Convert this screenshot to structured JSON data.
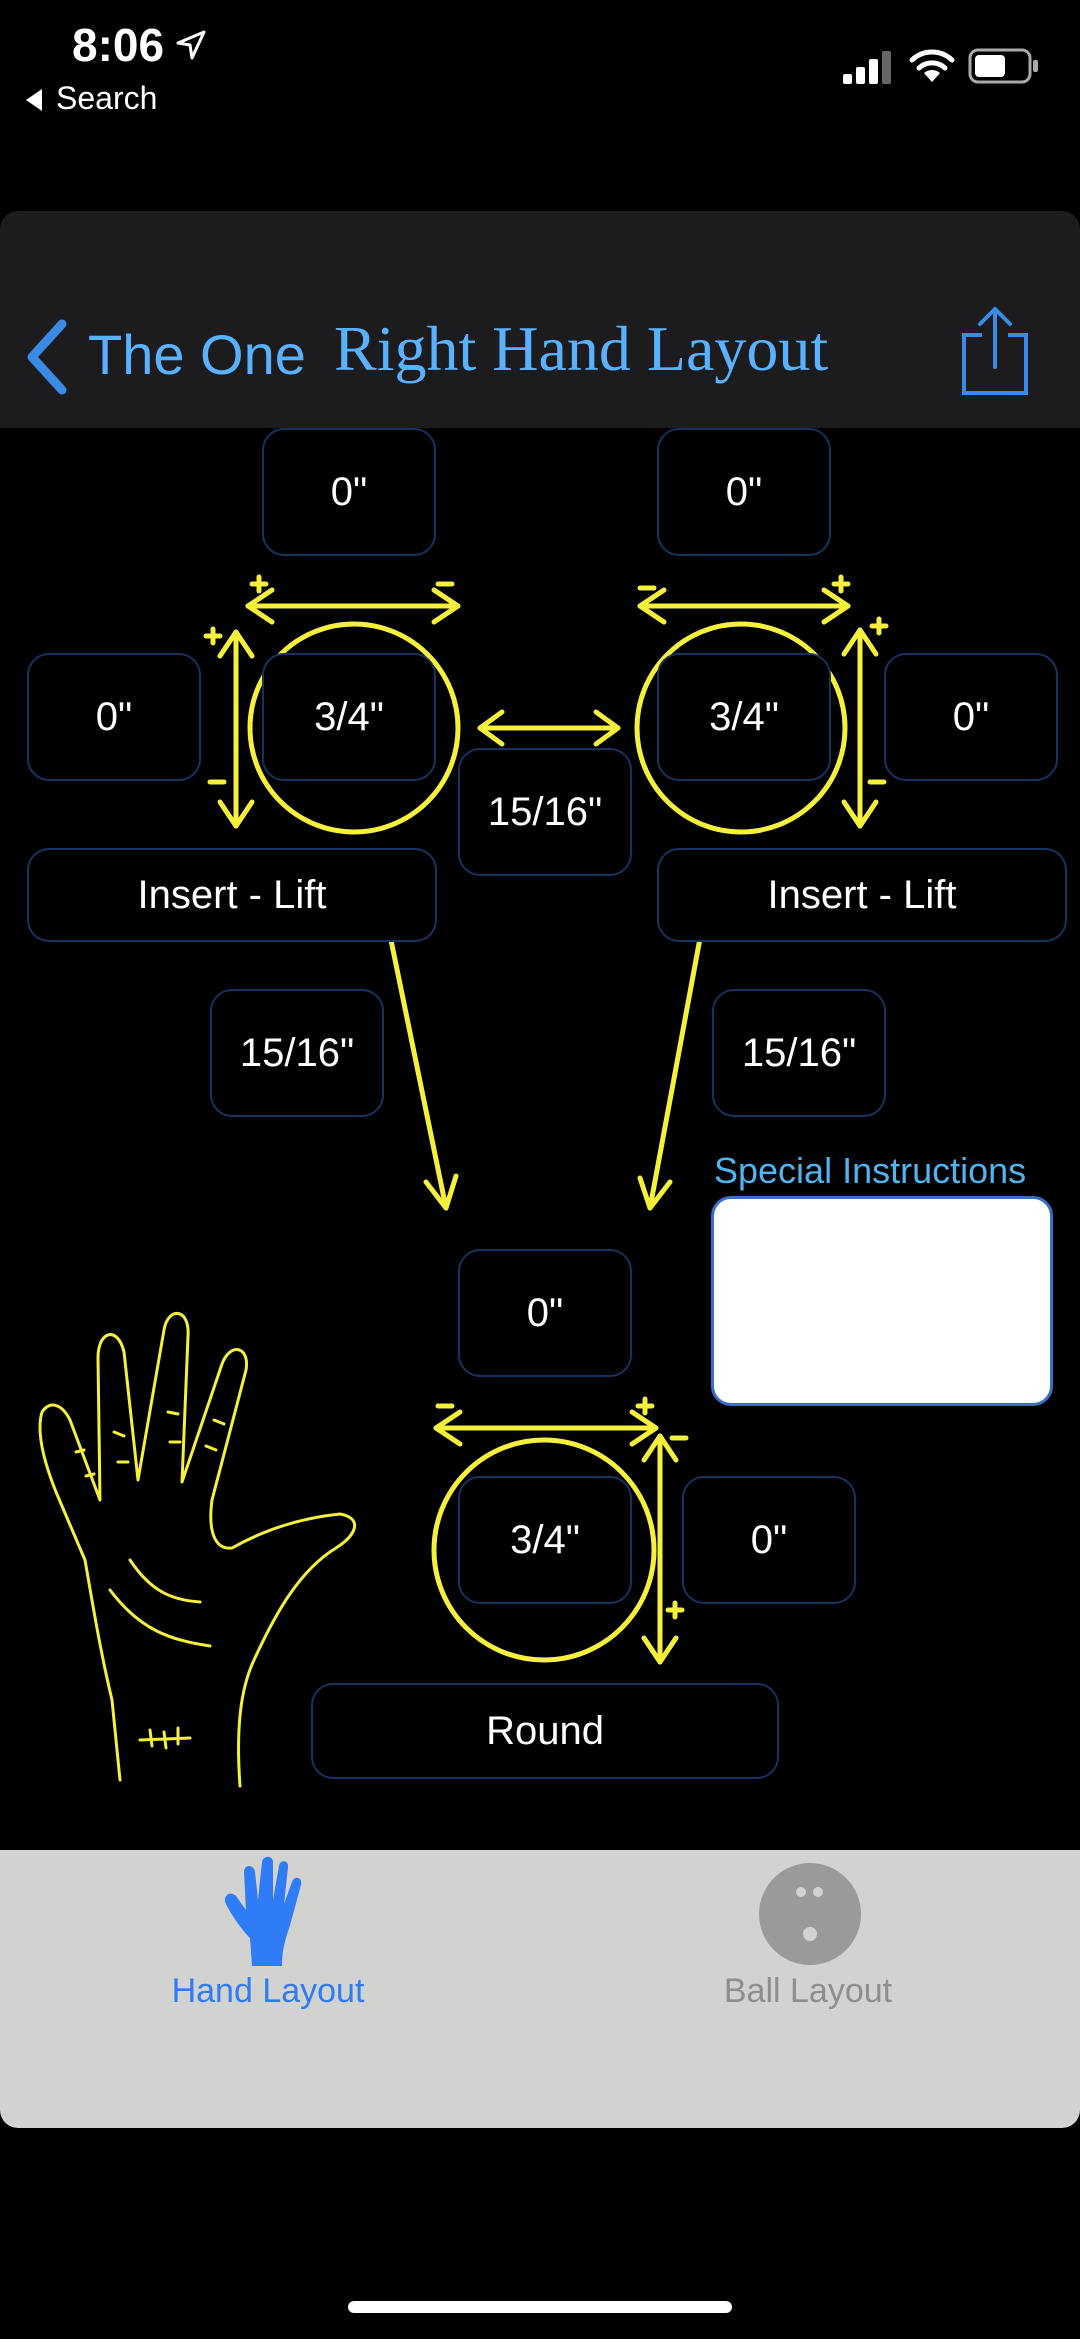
{
  "status_bar": {
    "time": "8:06",
    "back_label": "Search"
  },
  "nav": {
    "back_label": "The One",
    "title": "Right Hand Layout"
  },
  "left_finger": {
    "top_pitch": "0\"",
    "size": "3/4\"",
    "side_pitch": "0\"",
    "insert": "Insert - Lift",
    "span": "15/16\""
  },
  "right_finger": {
    "top_pitch": "0\"",
    "size": "3/4\"",
    "side_pitch": "0\"",
    "insert": "Insert - Lift",
    "span": "15/16\""
  },
  "bridge": "15/16\"",
  "thumb": {
    "top_pitch": "0\"",
    "size": "3/4\"",
    "side_pitch": "0\"",
    "shape": "Round"
  },
  "special_instructions": {
    "label": "Special Instructions",
    "value": ""
  },
  "tabs": [
    {
      "label": "Hand Layout",
      "icon": "hand-icon",
      "active": true
    },
    {
      "label": "Ball Layout",
      "icon": "bowling-ball-icon",
      "active": false
    }
  ],
  "colors": {
    "accent": "#5ab2ff",
    "diagram": "#f5f03c",
    "tab_active": "#2f7cf6",
    "tab_inactive": "#8e8e8e",
    "field_border": "#17325f"
  }
}
